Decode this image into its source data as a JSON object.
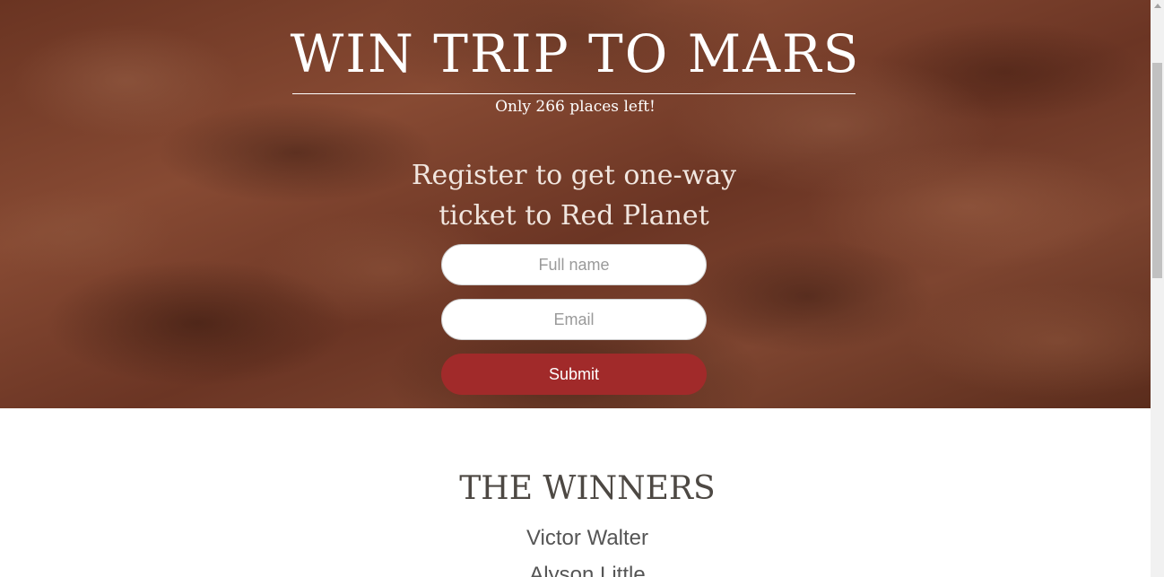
{
  "hero": {
    "title": "WIN TRIP TO MARS",
    "subtitle": "Only 266 places left!",
    "register_heading": "Register to get one-way ticket to Red Planet"
  },
  "form": {
    "full_name_placeholder": "Full name",
    "full_name_value": "",
    "email_placeholder": "Email",
    "email_value": "",
    "submit_label": "Submit"
  },
  "winners": {
    "title": "THE WINNERS",
    "names": [
      "Victor Walter",
      "Alyson Little"
    ]
  },
  "colors": {
    "submit_button": "#a12a2a",
    "hero_text": "#ffffff",
    "winners_title": "#4d4843"
  }
}
